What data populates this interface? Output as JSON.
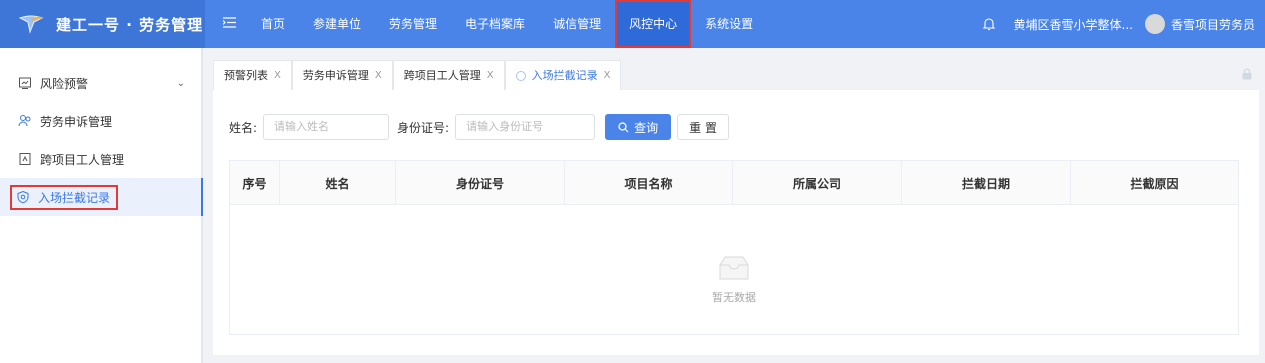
{
  "header": {
    "brand_title": "建工一号 · 劳务管理",
    "nav": [
      "首页",
      "参建单位",
      "劳务管理",
      "电子档案库",
      "诚信管理",
      "风控中心",
      "系统设置"
    ],
    "active_nav": "风控中心",
    "org": "黄埔区香雪小学整体...",
    "user": "香雪项目劳务员"
  },
  "sidebar": {
    "items": [
      {
        "label": "风险预警",
        "icon": "chart-icon"
      },
      {
        "label": "劳务申诉管理",
        "icon": "people-icon"
      },
      {
        "label": "跨项目工人管理",
        "icon": "document-icon"
      },
      {
        "label": "入场拦截记录",
        "icon": "shield-icon"
      }
    ]
  },
  "tabs": [
    {
      "label": "预警列表",
      "close": "X"
    },
    {
      "label": "劳务申诉管理",
      "close": "X"
    },
    {
      "label": "跨项目工人管理",
      "close": "X"
    },
    {
      "label": "入场拦截记录",
      "close": "X"
    }
  ],
  "search": {
    "name_label": "姓名:",
    "name_placeholder": "请输入姓名",
    "id_label": "身份证号:",
    "id_placeholder": "请输入身份证号",
    "query_btn": "查询",
    "reset_btn": "重 置"
  },
  "table": {
    "columns": [
      "序号",
      "姓名",
      "身份证号",
      "项目名称",
      "所属公司",
      "拦截日期",
      "拦截原因"
    ],
    "empty_text": "暂无数据"
  },
  "colors": {
    "primary": "#4a84e8",
    "highlight_border": "#e53935"
  }
}
